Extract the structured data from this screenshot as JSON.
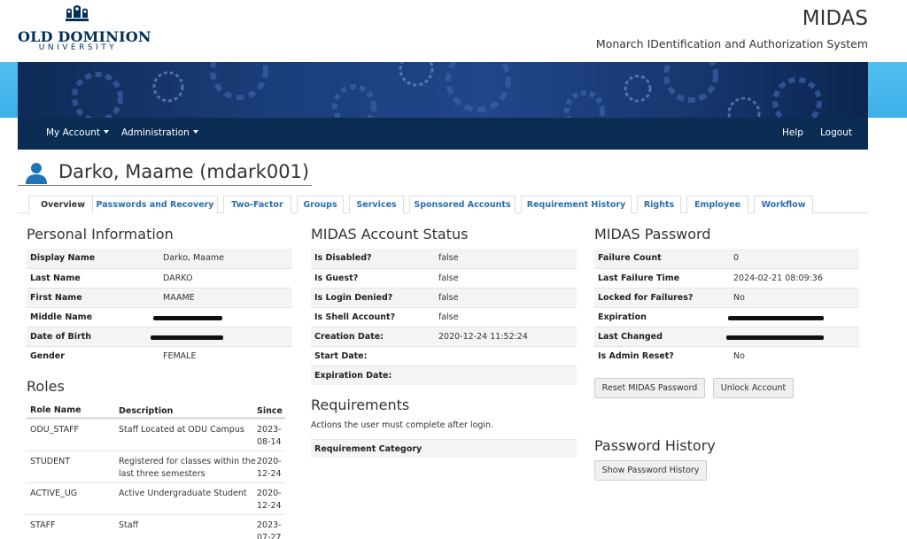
{
  "header": {
    "logo_main": "OLD DOMINION",
    "logo_sub": "UNIVERSITY",
    "brand": "MIDAS",
    "tagline": "Monarch IDentification and Authorization System"
  },
  "nav": {
    "left": [
      "My Account",
      "Administration"
    ],
    "right": [
      "Help",
      "Logout"
    ]
  },
  "page": {
    "title": "Darko, Maame (mdark001)"
  },
  "tabs": [
    "Overview",
    "Passwords and Recovery",
    "Two-Factor",
    "Groups",
    "Services",
    "Sponsored Accounts",
    "Requirement History",
    "Rights",
    "Employee",
    "Workflow"
  ],
  "personal": {
    "heading": "Personal Information",
    "rows": [
      {
        "label": "Display Name",
        "value": "Darko, Maame"
      },
      {
        "label": "Last Name",
        "value": "DARKO"
      },
      {
        "label": "First Name",
        "value": "MAAME"
      },
      {
        "label": "Middle Name",
        "value": ""
      },
      {
        "label": "Date of Birth",
        "value": ""
      },
      {
        "label": "Gender",
        "value": "FEMALE"
      }
    ]
  },
  "roles": {
    "heading": "Roles",
    "columns": [
      "Role Name",
      "Description",
      "Since"
    ],
    "rows": [
      {
        "name": "ODU_STAFF",
        "description": "Staff Located at ODU Campus",
        "since": "2023-08-14"
      },
      {
        "name": "STUDENT",
        "description": "Registered for classes within the last three semesters",
        "since": "2020-12-24"
      },
      {
        "name": "ACTIVE_UG",
        "description": "Active Undergraduate Student",
        "since": "2020-12-24"
      },
      {
        "name": "STAFF",
        "description": "Staff",
        "since": "2023-07-27"
      }
    ]
  },
  "account_status": {
    "heading": "MIDAS Account Status",
    "rows": [
      {
        "label": "Is Disabled?",
        "value": "false"
      },
      {
        "label": "Is Guest?",
        "value": "false"
      },
      {
        "label": "Is Login Denied?",
        "value": "false"
      },
      {
        "label": "Is Shell Account?",
        "value": "false"
      },
      {
        "label": "Creation Date:",
        "value": "2020-12-24 11:52:24"
      },
      {
        "label": "Start Date:",
        "value": ""
      },
      {
        "label": "Expiration Date:",
        "value": ""
      }
    ]
  },
  "requirements": {
    "heading": "Requirements",
    "description": "Actions the user must complete after login.",
    "column": "Requirement Category"
  },
  "password": {
    "heading": "MIDAS Password",
    "rows": [
      {
        "label": "Failure Count",
        "value": "0"
      },
      {
        "label": "Last Failure Time",
        "value": "2024-02-21 08:09:36"
      },
      {
        "label": "Locked for Failures?",
        "value": "No"
      },
      {
        "label": "Expiration",
        "value": ""
      },
      {
        "label": "Last Changed",
        "value": ""
      },
      {
        "label": "Is Admin Reset?",
        "value": "No"
      }
    ],
    "reset_button": "Reset MIDAS Password",
    "unlock_button": "Unlock Account"
  },
  "password_history": {
    "heading": "Password History",
    "button": "Show Password History"
  },
  "colors": {
    "navy": "#0b2d54",
    "banner_blue": "#3db0e9",
    "link_blue": "#2a6fb0",
    "user_icon": "#1f74b8"
  }
}
